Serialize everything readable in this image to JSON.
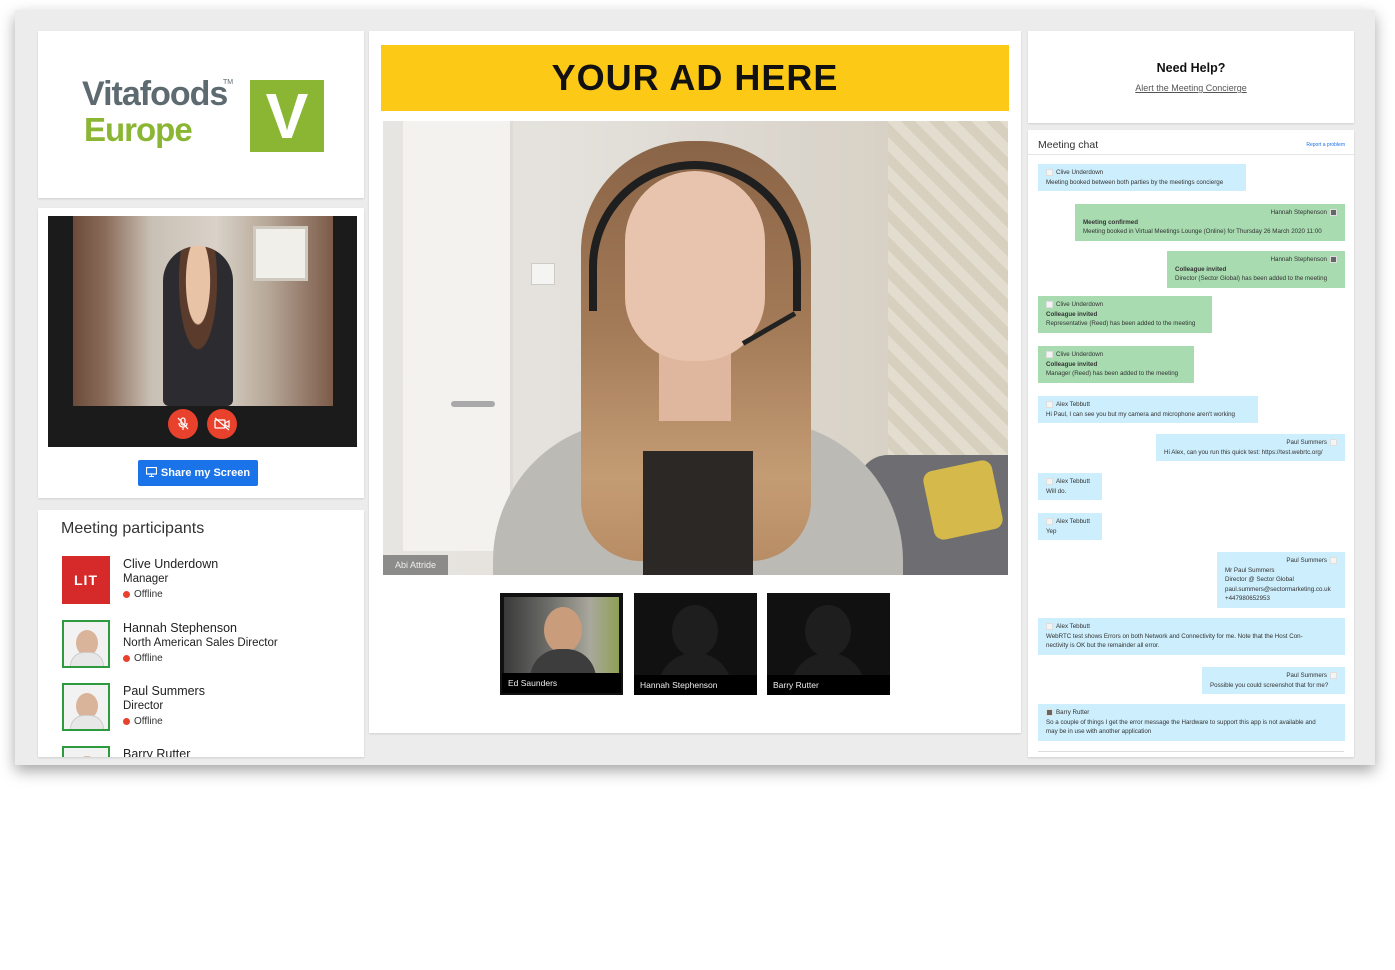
{
  "logo": {
    "line1": "Vitafoods",
    "line2": "Europe",
    "tm": "TM",
    "mark": "V"
  },
  "self_view": {
    "mic_icon": "mic-off-icon",
    "cam_icon": "video-off-icon"
  },
  "share_button": {
    "label": "Share my Screen",
    "icon": "monitor-icon"
  },
  "participants": {
    "title": "Meeting participants",
    "items": [
      {
        "name": "Clive Underdown",
        "role": "Manager",
        "status": "Offline",
        "avatar_text": "LIT"
      },
      {
        "name": "Hannah Stephenson",
        "role": "North American Sales Director",
        "status": "Offline"
      },
      {
        "name": "Paul Summers",
        "role": "Director",
        "status": "Offline"
      },
      {
        "name": "Barry Rutter",
        "role": "",
        "status": ""
      }
    ]
  },
  "ad_banner": "YOUR AD HERE",
  "main_video": {
    "label": "Abi Attride"
  },
  "thumbnails": [
    {
      "label": "Ed Saunders"
    },
    {
      "label": "Hannah Stephenson"
    },
    {
      "label": "Barry Rutter"
    }
  ],
  "help": {
    "title": "Need Help?",
    "link": "Alert the Meeting Concierge"
  },
  "chat": {
    "title": "Meeting chat",
    "report": "Report a problem",
    "messages": [
      {
        "sender": "Clive Underdown",
        "heading": "",
        "text": "Meeting booked between both parties by the meetings concierge"
      },
      {
        "sender": "Hannah Stephenson",
        "heading": "Meeting confirmed",
        "text": "Meeting booked in Virtual Meetings Lounge (Online) for Thursday 26 March 2020 11:00"
      },
      {
        "sender": "Hannah Stephenson",
        "heading": "Colleague invited",
        "text": "Director (Sector Global) has been added to the meeting"
      },
      {
        "sender": "Clive Underdown",
        "heading": "Colleague invited",
        "text": "Representative (Reed) has been added to the meeting"
      },
      {
        "sender": "Clive Underdown",
        "heading": "Colleague invited",
        "text": "Manager (Reed) has been added to the meeting"
      },
      {
        "sender": "Alex Tebbutt",
        "heading": "",
        "text": "Hi Paul, I can see you but my camera and microphone aren't working"
      },
      {
        "sender": "Paul Summers",
        "heading": "",
        "text": "Hi Alex, can you run this quick test: https://test.webrtc.org/"
      },
      {
        "sender": "Alex Tebbutt",
        "heading": "",
        "text": "Will do."
      },
      {
        "sender": "Alex Tebbutt",
        "heading": "",
        "text": "Yep"
      },
      {
        "sender": "Paul Summers",
        "heading": "",
        "text": "Mr Paul Summers",
        "line2": "Director @ Sector Global",
        "line3": "paul.summers@sectormarketing.co.uk",
        "line4": "+447980652953"
      },
      {
        "sender": "Alex Tebbutt",
        "heading": "",
        "text": "WebRTC test shows Errors on both Network and Connectivity for me. Note that the Host Con-",
        "line2": "nectivity is OK but the remainder all error."
      },
      {
        "sender": "Paul Summers",
        "heading": "",
        "text": "Possible you could screenshot that for me?"
      },
      {
        "sender": "Barry Rutter",
        "heading": "",
        "text": "So a couple of things I get the error message the Hardware to support this app is not available and",
        "line2": "may be in use with another application"
      }
    ]
  },
  "colors": {
    "accent_green": "#8ab634",
    "ad_yellow": "#fcc916",
    "share_blue": "#1a73e8",
    "offline_red": "#e8412c",
    "chat_blue": "#cdeefc",
    "chat_green": "#a8dbb0"
  }
}
